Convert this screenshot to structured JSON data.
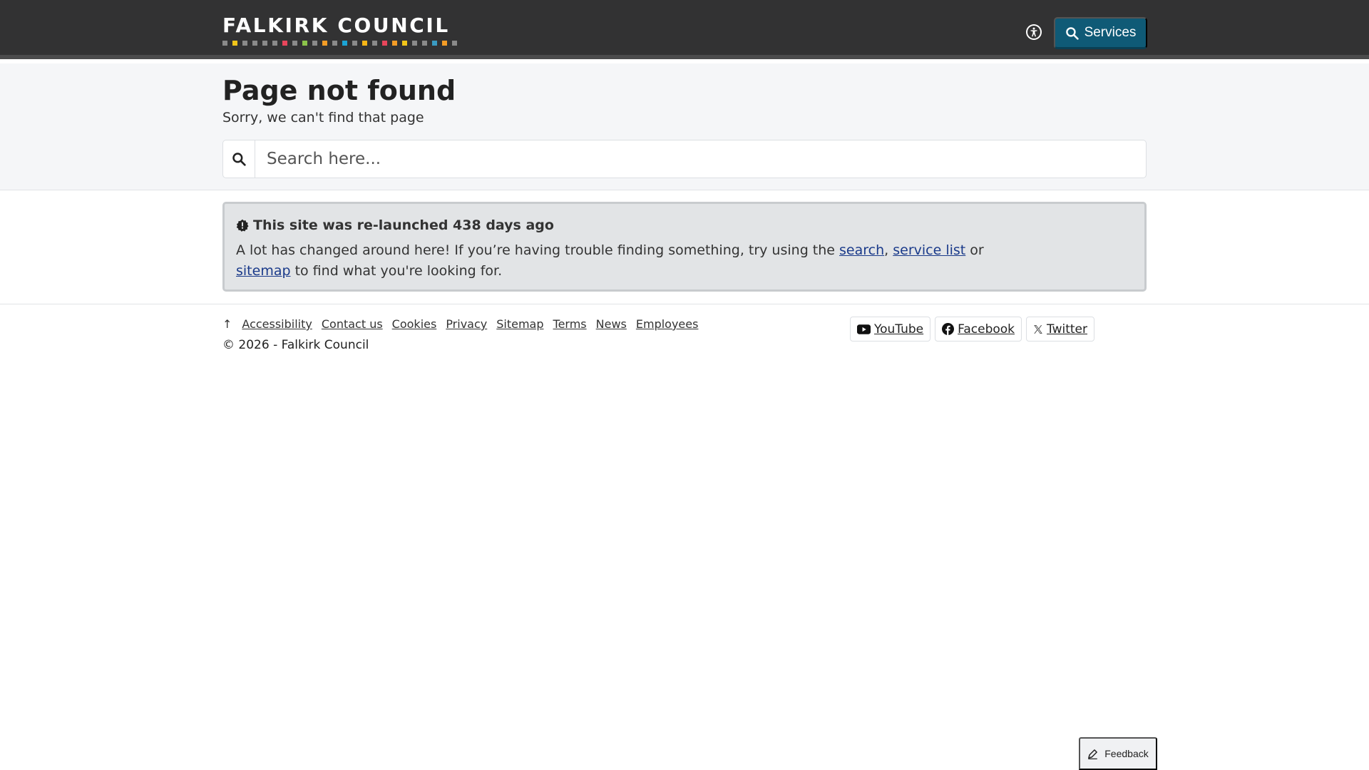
{
  "header": {
    "logo_text": "FALKIRK COUNCIL",
    "logo_dot_colors": [
      "#8a8a8a",
      "#f0c419",
      "#8a8a8a",
      "#8a8a8a",
      "#8a8a8a",
      "#8a8a8a",
      "#e8455b",
      "#8a8a8a",
      "#8bc34a",
      "#8a8a8a",
      "#f39c26",
      "#8a8a8a",
      "#1ba3d4",
      "#8a8a8a",
      "#f7b516",
      "#8a8a8a",
      "#e8455b",
      "#f39c26",
      "#f0c419",
      "#8a8a8a",
      "#8a8a8a",
      "#3a9bc2",
      "#f39c26",
      "#8a8a8a"
    ],
    "accessibility_icon": "accessibility-icon",
    "services_label": "Services"
  },
  "banner": {
    "title": "Page not found",
    "subtitle": "Sorry, we can't find that page",
    "search_placeholder": "Search here..."
  },
  "notice": {
    "title": "This site was re-launched 438 days ago",
    "body_prefix": "A lot has changed around here! If you’re having trouble finding something, try using the ",
    "link_search": "search",
    "sep_comma": ", ",
    "link_service_list": "service list",
    "sep_or": " or ",
    "link_sitemap": "sitemap",
    "body_suffix": " to find what you're looking for."
  },
  "footer": {
    "top_arrow": "↑",
    "links": [
      "Accessibility",
      "Contact us",
      "Cookies",
      "Privacy",
      "Sitemap",
      "Terms",
      "News",
      "Employees"
    ],
    "copyright": "© 2026 - Falkirk Council",
    "social": {
      "youtube": "YouTube",
      "facebook": "Facebook",
      "twitter": "Twitter"
    }
  },
  "feedback": {
    "label": "Feedback"
  },
  "colors": {
    "header_bg": "#323233",
    "services_button": "#0f5a76",
    "link": "#1a3a8a"
  }
}
